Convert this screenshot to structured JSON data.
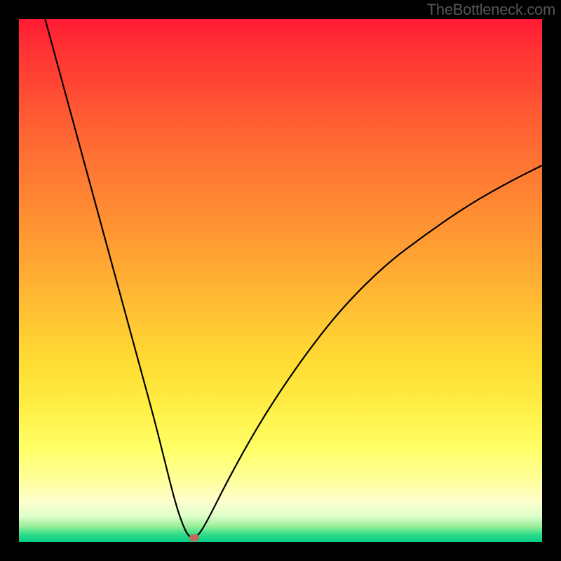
{
  "attribution": "TheBottleneck.com",
  "chart_data": {
    "type": "line",
    "title": "",
    "xlabel": "",
    "ylabel": "",
    "xlim": [
      0,
      100
    ],
    "ylim": [
      100,
      0
    ],
    "background": {
      "description": "Vertical gradient from red (top, high bottleneck) through orange and yellow to green (bottom, no bottleneck)"
    },
    "series": [
      {
        "name": "bottleneck-curve",
        "description": "V-shaped curve showing bottleneck percentage vs. component match. Steep descent from top-left to a minimum near x≈32, then concave rise toward top-right.",
        "x": [
          5,
          8,
          11,
          14,
          17,
          20,
          23,
          26,
          28,
          29.5,
          31,
          32.5,
          34,
          36,
          40,
          45,
          50,
          56,
          62,
          70,
          78,
          86,
          94,
          100
        ],
        "y": [
          0,
          11,
          22,
          33,
          44,
          55,
          66,
          77,
          85,
          91,
          96,
          99.2,
          99.2,
          96,
          88,
          79,
          71,
          62.5,
          55,
          47,
          41,
          35.5,
          31,
          28
        ]
      }
    ],
    "marker": {
      "name": "optimum-point",
      "x": 33.5,
      "y": 99.2,
      "color": "#c26a5c"
    }
  }
}
